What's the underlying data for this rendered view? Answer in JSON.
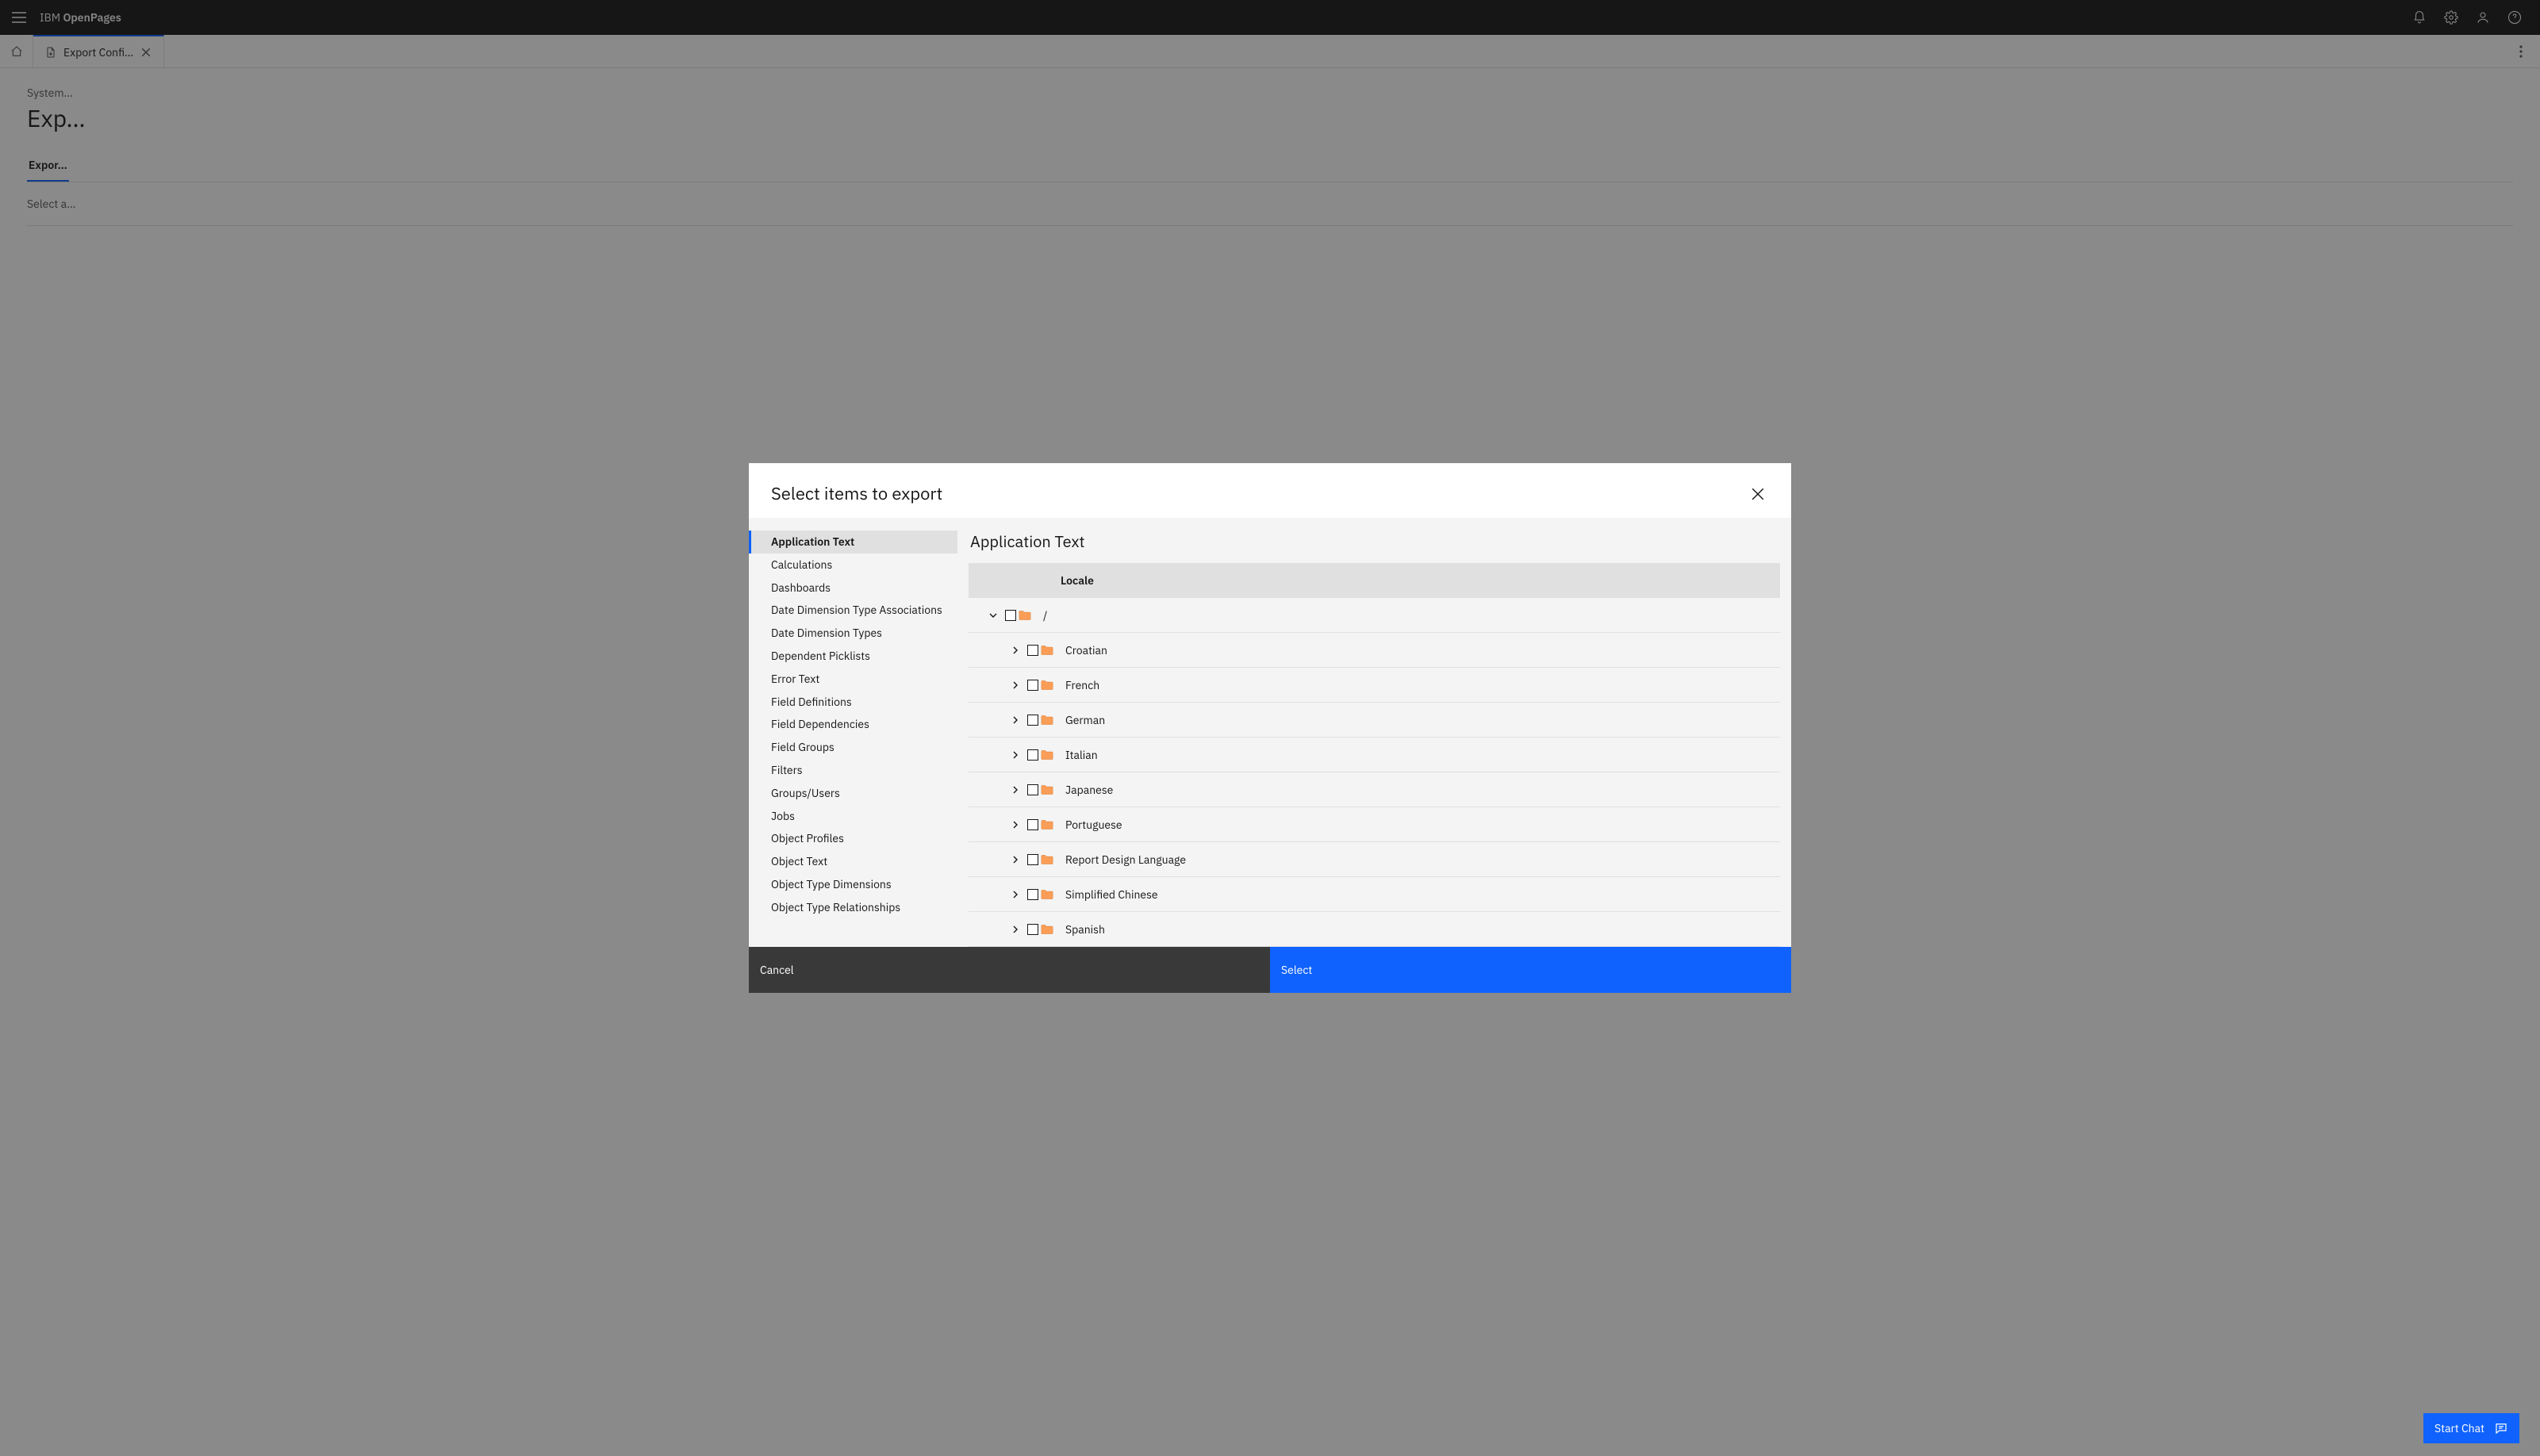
{
  "brand": {
    "prefix": "IBM",
    "product": "OpenPages"
  },
  "tabs": {
    "active_label": "Export Confi…"
  },
  "page": {
    "breadcrumb": "System…",
    "title": "Exp…",
    "subtabs": [
      "Expor…"
    ],
    "hint": "Select a…"
  },
  "modal": {
    "title": "Select items to export",
    "categories": [
      "Application Text",
      "Calculations",
      "Dashboards",
      "Date Dimension Type Associations",
      "Date Dimension Types",
      "Dependent Picklists",
      "Error Text",
      "Field Definitions",
      "Field Dependencies",
      "Field Groups",
      "Filters",
      "Groups/Users",
      "Jobs",
      "Object Profiles",
      "Object Text",
      "Object Type Dimensions",
      "Object Type Relationships"
    ],
    "active_category_index": 0,
    "panel_title": "Application Text",
    "column_header": "Locale",
    "root_label": "/",
    "locales": [
      "Croatian",
      "French",
      "German",
      "Italian",
      "Japanese",
      "Portuguese",
      "Report Design Language",
      "Simplified Chinese",
      "Spanish"
    ],
    "cancel_label": "Cancel",
    "select_label": "Select"
  },
  "chat": {
    "label": "Start Chat"
  }
}
